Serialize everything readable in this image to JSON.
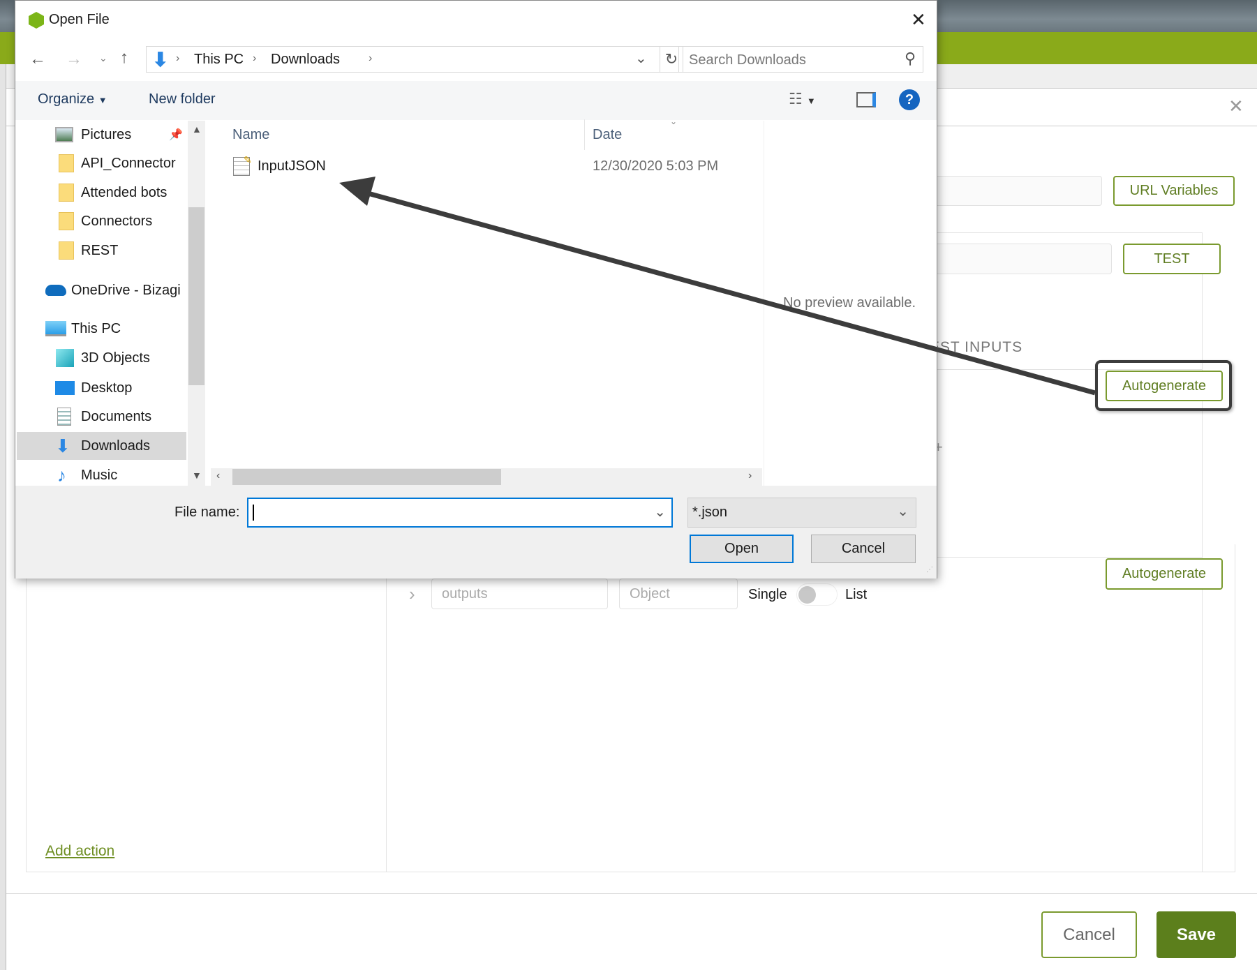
{
  "background_app": {
    "url_variables_label": "URL Variables",
    "test_label": "TEST",
    "test_inputs_heading": "TEST INPUTS",
    "autogenerate_inputs_label": "Autogenerate",
    "autogenerate_outputs_label": "Autogenerate",
    "outputs_name_placeholder": "outputs",
    "outputs_type_placeholder": "Object",
    "single_label": "Single",
    "list_label": "List",
    "add_action_label": "Add action",
    "cancel_label": "Cancel",
    "save_label": "Save",
    "accent_color": "#8aaa1a"
  },
  "dialog": {
    "title": "Open File",
    "breadcrumb": [
      "This PC",
      "Downloads"
    ],
    "search_placeholder": "Search Downloads",
    "toolbar": {
      "organize_label": "Organize",
      "new_folder_label": "New folder"
    },
    "nav_items": [
      {
        "label": "Pictures",
        "icon": "pictures-icon",
        "pinned": true
      },
      {
        "label": "API_Connector",
        "icon": "folder-icon"
      },
      {
        "label": "Attended bots",
        "icon": "folder-icon"
      },
      {
        "label": "Connectors",
        "icon": "folder-icon"
      },
      {
        "label": "REST",
        "icon": "folder-icon"
      },
      {
        "label": "OneDrive - Bizagi",
        "icon": "onedrive-icon"
      },
      {
        "label": "This PC",
        "icon": "computer-icon"
      },
      {
        "label": "3D Objects",
        "icon": "cube-icon"
      },
      {
        "label": "Desktop",
        "icon": "desktop-icon"
      },
      {
        "label": "Documents",
        "icon": "documents-icon"
      },
      {
        "label": "Downloads",
        "icon": "download-icon",
        "selected": true
      },
      {
        "label": "Music",
        "icon": "music-icon"
      }
    ],
    "columns": {
      "name": "Name",
      "date": "Date"
    },
    "files": [
      {
        "name": "InputJSON",
        "date": "12/30/2020 5:03 PM"
      }
    ],
    "preview_text": "No preview available.",
    "file_name_label": "File name:",
    "file_name_value": "",
    "filter_value": "*.json",
    "open_label": "Open",
    "cancel_label": "Cancel"
  }
}
